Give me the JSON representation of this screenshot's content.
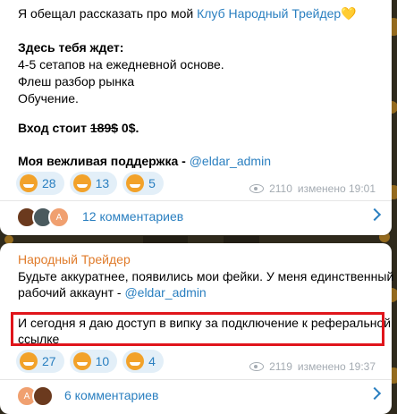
{
  "post1": {
    "line1_prefix": "Я обещал рассказать про мой ",
    "line1_link": "Клуб Народный Трейдер",
    "line1_heart": "💛",
    "line2": "Здесь тебя ждет:",
    "line3": "4-5 сетапов на ежедневной основе.",
    "line4": "Флеш разбор рынка",
    "line5": "Обучение.",
    "price_prefix": "Вход стоит ",
    "price_old": "189$",
    "price_new": " 0$.",
    "support_prefix": "Моя вежливая поддержка - ",
    "support_link": "@eldar_admin",
    "reactions": [
      "28",
      "13",
      "5"
    ],
    "views": "2110",
    "edited": "изменено 19:01",
    "comments": "12 комментариев",
    "avatar_letter": "A"
  },
  "post2": {
    "author": "Народный Трейдер",
    "line1": "Будьте аккуратнее, появились мои фейки. У меня единственный",
    "line2_prefix": "рабочий аккаунт - ",
    "line2_link": "@eldar_admin",
    "line3": "И сегодня я даю доступ в випку за подключение к реферальной",
    "line4": "ссылке",
    "reactions": [
      "27",
      "10",
      "4"
    ],
    "views": "2119",
    "edited": "изменено 19:37",
    "comments": "6 комментариев",
    "avatar_letter": "A"
  },
  "colors": {
    "link": "#2a7fc0",
    "author": "#e07b2a",
    "highlight": "#e0151b"
  }
}
